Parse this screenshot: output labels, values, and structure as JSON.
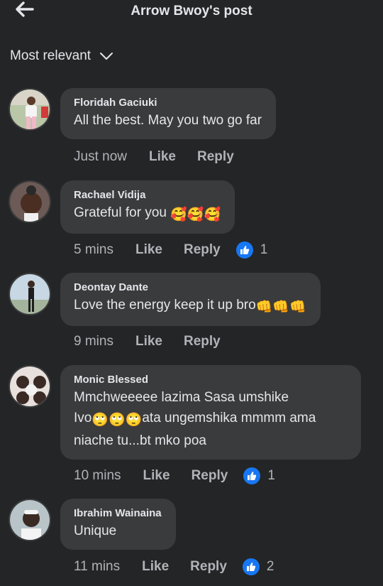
{
  "header": {
    "title": "Arrow Bwoy's post",
    "back_icon": "arrow-left-icon"
  },
  "sort": {
    "label": "Most relevant",
    "icon": "chevron-down-icon"
  },
  "actions": {
    "like": "Like",
    "reply": "Reply"
  },
  "comments": [
    {
      "name": "Floridah Gaciuki",
      "text": "All the best. May you two go far",
      "time": "Just now",
      "reactions": null
    },
    {
      "name": "Rachael Vidija",
      "text": "Grateful for you",
      "emoji": "🥰🥰🥰",
      "time": "5 mins",
      "reactions": "1"
    },
    {
      "name": "Deontay Dante",
      "text": "Love the energy keep it up bro",
      "emoji": "👊👊👊",
      "time": "9 mins",
      "reactions": null
    },
    {
      "name": "Monic Blessed",
      "text_line1": "Mmchweeeee lazima Sasa umshike",
      "text_line2a": "Ivo",
      "emoji": "🙄🙄🙄",
      "text_line2b": "ata ungemshika mmmm ama",
      "text_line3": "niache tu...bt mko poa",
      "time": "10 mins",
      "reactions": "1"
    },
    {
      "name": "Ibrahim Wainaina",
      "text": "Unique",
      "time": "11 mins",
      "reactions": "2"
    }
  ],
  "colors": {
    "background": "#242526",
    "bubble": "#3a3b3c",
    "like_blue": "#1877f2",
    "muted": "#b0b3b8"
  }
}
